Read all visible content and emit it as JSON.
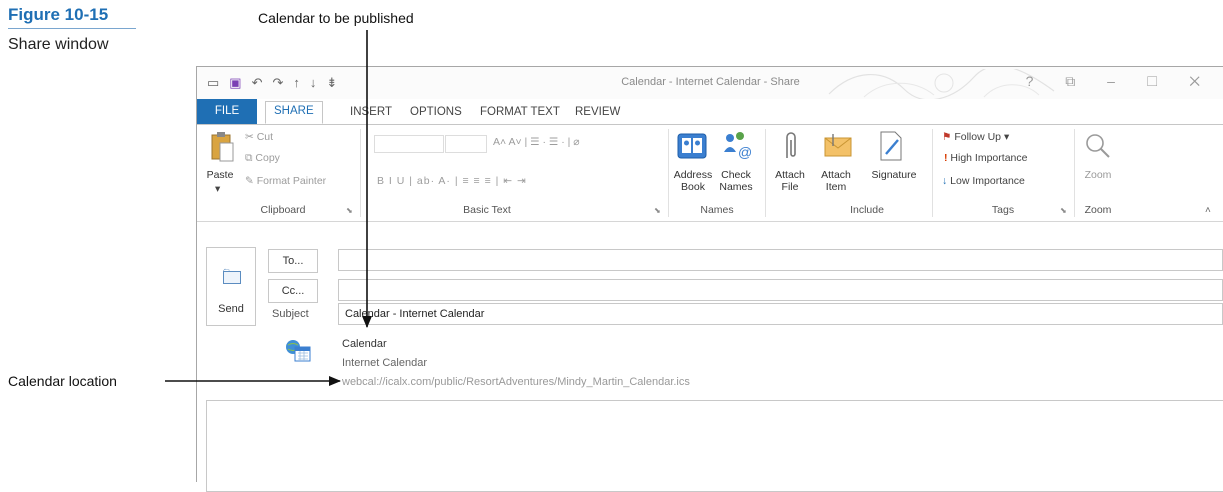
{
  "figure": {
    "number": "Figure 10-15",
    "caption": "Share window",
    "callout_top": "Calendar to be published",
    "callout_left": "Calendar location"
  },
  "window": {
    "title": "Calendar - Internet Calendar - Share",
    "controls": "? ⧉ – ☐ ✕"
  },
  "tabs": [
    "FILE",
    "SHARE",
    "INSERT",
    "OPTIONS",
    "FORMAT TEXT",
    "REVIEW"
  ],
  "ribbon": {
    "clipboard": {
      "paste": "Paste",
      "cut": "Cut",
      "copy": "Copy",
      "format_painter": "Format Painter",
      "label": "Clipboard"
    },
    "basic_text": {
      "label": "Basic Text",
      "row1": "A˄ A˅ | ☰ · ☰ · | ⌀",
      "row2": "B I U | ab· A· | ≡ ≡ ≡ | ⇤ ⇥"
    },
    "names": {
      "address_book": "Address Book",
      "check_names": "Check Names",
      "label": "Names"
    },
    "include": {
      "attach_file": "Attach File",
      "attach_item": "Attach Item",
      "signature": "Signature",
      "label": "Include"
    },
    "tags": {
      "follow_up": "Follow Up",
      "high": "High Importance",
      "low": "Low Importance",
      "label": "Tags"
    },
    "zoom": {
      "button": "Zoom",
      "label": "Zoom"
    }
  },
  "compose": {
    "send": "Send",
    "to": "To...",
    "cc": "Cc...",
    "subject_label": "Subject",
    "subject_value": "Calendar - Internet Calendar",
    "share_name": "Calendar",
    "share_type": "Internet Calendar",
    "share_url": "webcal://icalx.com/public/ResortAdventures/Mindy_Martin_Calendar.ics"
  },
  "colors": {
    "accent": "#1f6fb4",
    "high_importance": "#d83b01",
    "low_importance": "#1f6fb4"
  }
}
